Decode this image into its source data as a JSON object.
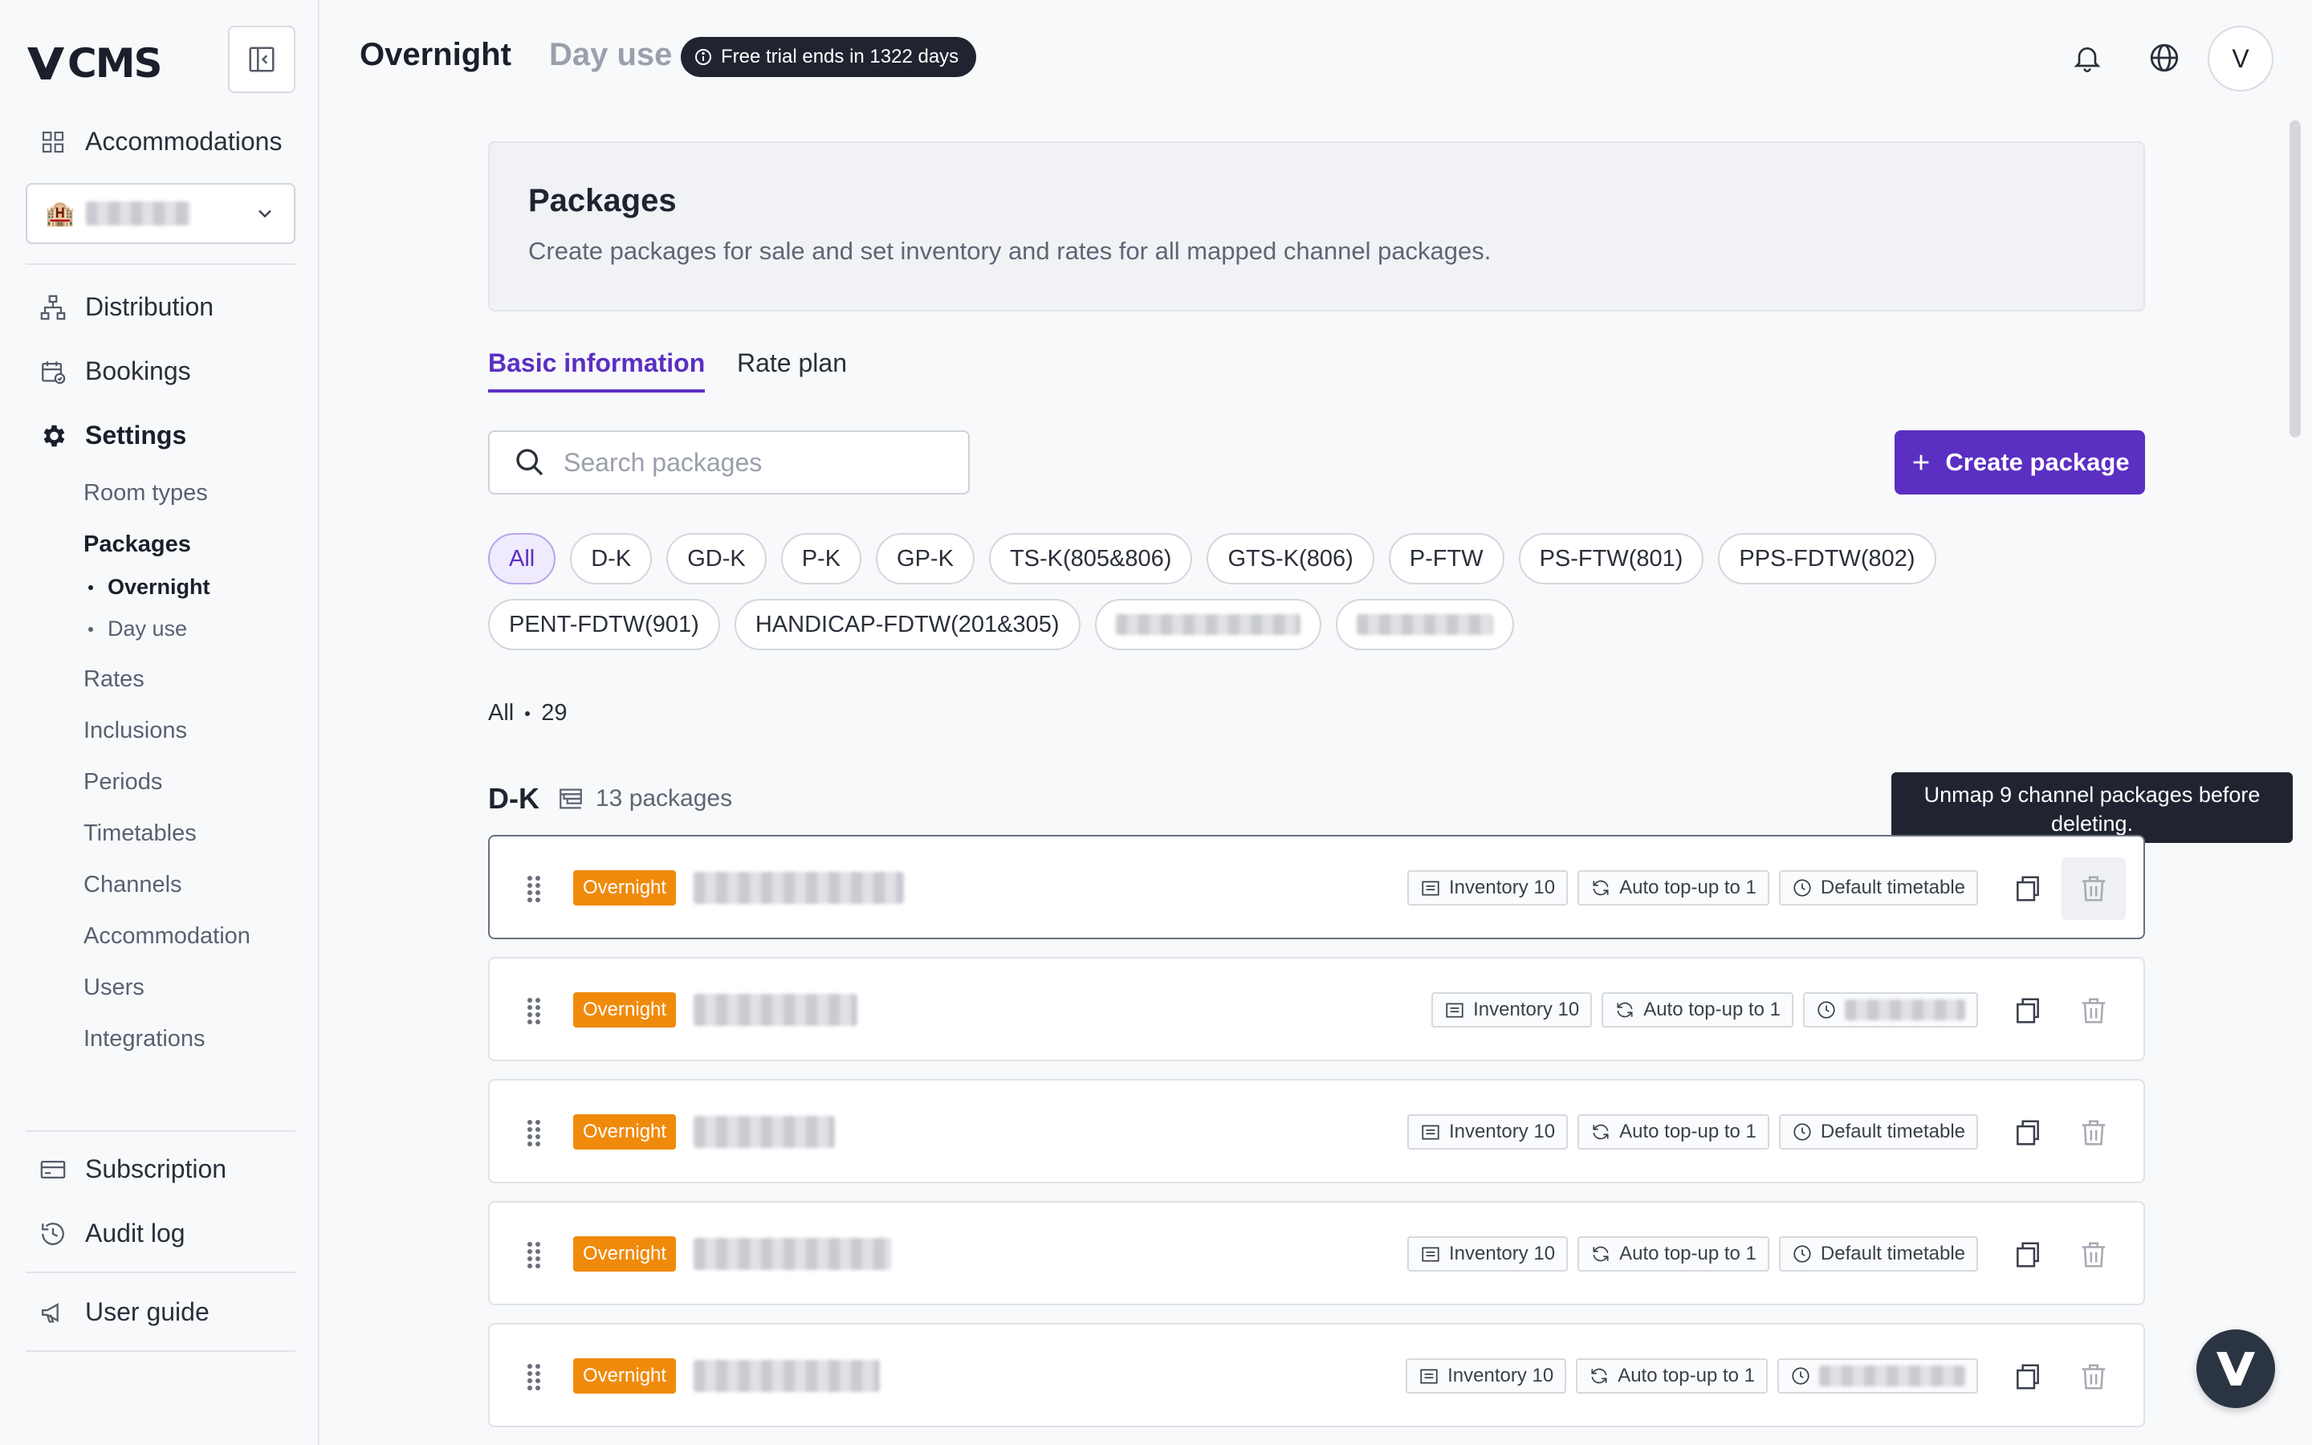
{
  "app": {
    "logo_text": "CMS"
  },
  "sidebar": {
    "accommodations": "Accommodations",
    "distribution": "Distribution",
    "bookings": "Bookings",
    "settings": "Settings",
    "settings_items": [
      "Room types",
      "Packages",
      "Rates",
      "Inclusions",
      "Periods",
      "Timetables",
      "Channels",
      "Accommodation",
      "Users",
      "Integrations"
    ],
    "package_sub": [
      "Overnight",
      "Day use"
    ],
    "subscription": "Subscription",
    "audit_log": "Audit log",
    "user_guide": "User guide"
  },
  "topbar": {
    "tab_overnight": "Overnight",
    "tab_dayuse": "Day use",
    "trial": "Free trial ends in 1322 days",
    "avatar": "V"
  },
  "header": {
    "title": "Packages",
    "description": "Create packages for sale and set inventory and rates for all mapped channel packages."
  },
  "tabs": [
    "Basic information",
    "Rate plan"
  ],
  "search": {
    "placeholder": "Search packages"
  },
  "create_button": "Create package",
  "filters": {
    "row1": [
      "All",
      "D-K",
      "GD-K",
      "P-K",
      "GP-K",
      "TS-K(805&806)",
      "GTS-K(806)",
      "P-FTW",
      "PS-FTW(801)",
      "PPS-FDTW(802)"
    ],
    "row2": [
      "PENT-FDTW(901)",
      "HANDICAP-FDTW(201&305)"
    ]
  },
  "count": {
    "label": "All",
    "value": "29"
  },
  "group": {
    "name": "D-K",
    "packages": "13 packages"
  },
  "tooltip": "Unmap 9 channel packages before deleting.",
  "rows": [
    {
      "badge": "Overnight",
      "inventory": "Inventory 10",
      "topup": "Auto top-up to 1",
      "timetable": "Default timetable"
    },
    {
      "badge": "Overnight",
      "inventory": "Inventory 10",
      "topup": "Auto top-up to 1",
      "timetable": ""
    },
    {
      "badge": "Overnight",
      "inventory": "Inventory 10",
      "topup": "Auto top-up to 1",
      "timetable": "Default timetable"
    },
    {
      "badge": "Overnight",
      "inventory": "Inventory 10",
      "topup": "Auto top-up to 1",
      "timetable": "Default timetable"
    },
    {
      "badge": "Overnight",
      "inventory": "Inventory 10",
      "topup": "Auto top-up to 1",
      "timetable": ""
    }
  ],
  "colors": {
    "accent": "#5b2fc2",
    "badge": "#f08a0b",
    "dark": "#1f2430"
  }
}
